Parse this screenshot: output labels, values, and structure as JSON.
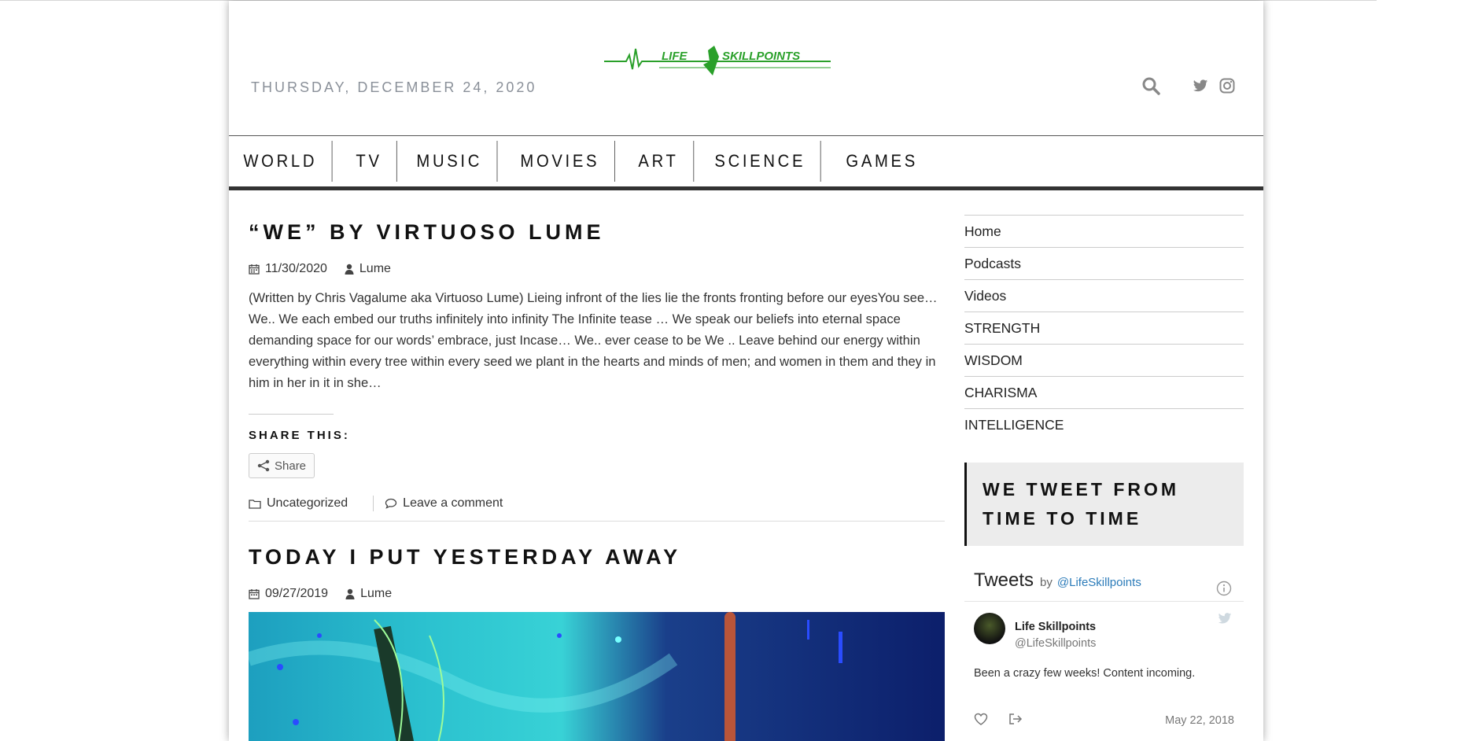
{
  "header": {
    "date": "THURSDAY, DECEMBER 24, 2020",
    "logo_text": "LIFE SKILLPOINTS"
  },
  "nav": {
    "items": [
      "WORLD",
      "TV",
      "MUSIC",
      "MOVIES",
      "ART",
      "SCIENCE",
      "GAMES"
    ]
  },
  "posts": [
    {
      "title": "“WE” BY VIRTUOSO LUME",
      "date": "11/30/2020",
      "author": "Lume",
      "excerpt": "(Written by Chris Vagalume aka Virtuoso Lume) Lieing infront of the lies lie the fronts fronting before our eyesYou see… We.. We each embed our truths infinitely into infinity The Infinite tease … We speak our beliefs into eternal space demanding space for our words’ embrace, just Incase… We.. ever cease to be We .. Leave behind our energy within everything within every tree within every seed we plant in the hearts and minds of men; and women in them and they in him in her in it in she…",
      "share_label": "SHARE THIS:",
      "share_button": "Share",
      "category": "Uncategorized",
      "comment_link": "Leave a comment"
    },
    {
      "title": "TODAY I PUT YESTERDAY AWAY",
      "date": "09/27/2019",
      "author": "Lume"
    }
  ],
  "sidebar": {
    "menu": [
      "Home",
      "Podcasts",
      "Videos",
      "STRENGTH",
      "WISDOM",
      "CHARISMA",
      "INTELLIGENCE"
    ],
    "widget_title": "WE TWEET FROM TIME TO TIME",
    "tweets": {
      "heading": "Tweets",
      "by": "by",
      "handle_link": "@LifeSkillpoints",
      "tweet": {
        "name": "Life Skillpoints",
        "handle": "@LifeSkillpoints",
        "text": "Been a crazy few weeks! Content incoming.",
        "date": "May 22, 2018"
      }
    }
  },
  "colors": {
    "logo_green": "#2aa02a",
    "date_gray": "#8a9099",
    "twitter_blue": "#2b7bb9"
  }
}
